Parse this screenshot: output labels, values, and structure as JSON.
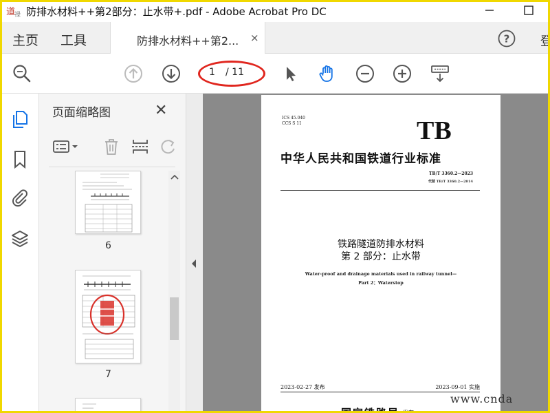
{
  "window": {
    "title": "防排水材料++第2部分：止水带+.pdf - Adobe Acrobat Pro DC",
    "logo_text": "道·禄网"
  },
  "tabs": {
    "home": "主页",
    "tools": "工具",
    "document": "防排水材料++第2...",
    "close": "×",
    "signin": "登"
  },
  "toolbar": {
    "current_page": "1",
    "total_pages": "/ 11",
    "highlight_color": "#e0261e",
    "accent_color": "#1473e6"
  },
  "panel": {
    "title": "页面缩略图",
    "close": "✕",
    "thumbnails": [
      {
        "page": "6"
      },
      {
        "page": "7"
      }
    ]
  },
  "document": {
    "ics": "ICS 45.040",
    "ccs": "CCS S 11",
    "logo": "TB",
    "standard_title": "中华人民共和国铁道行业标准",
    "code": "TB/T 3360.2—2023",
    "replaces": "代替 TB/T 3360.2—2014",
    "title_line1": "铁路隧道防排水材料",
    "title_line2": "第 2 部分：止水带",
    "en_line1": "Water-proof and drainage materials used in railway tunnel—",
    "en_line2": "Part 2：Waterstop",
    "issue_date": "2023-02-27 发布",
    "impl_date": "2023-09-01 实施",
    "issuer": "国家铁路局",
    "issuer_suffix": "发布"
  },
  "watermark": "www.cnda"
}
